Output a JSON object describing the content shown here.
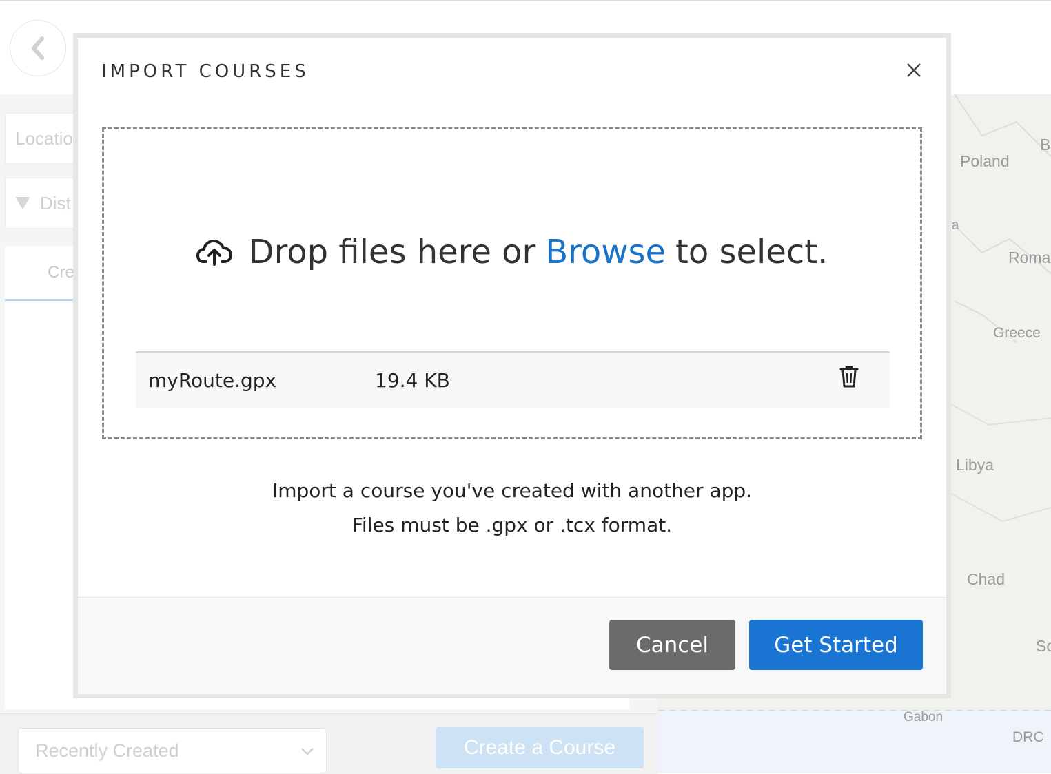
{
  "background": {
    "location_placeholder": "Locatio",
    "distance_label": "Dist",
    "tab_label": "Cre",
    "sort_select_value": "Recently Created",
    "create_course_label": "Create a Course",
    "map_labels": [
      "Poland",
      "tria",
      "Roma",
      "Greece",
      "Libya",
      "Chad",
      "Gabon",
      "DRC",
      "B",
      "So"
    ]
  },
  "modal": {
    "title": "IMPORT COURSES",
    "close_icon": "close-icon",
    "dropzone": {
      "upload_icon": "cloud-upload-icon",
      "text_before": "Drop files here or",
      "browse_link": "Browse",
      "text_after": "to select."
    },
    "files": [
      {
        "name": "myRoute.gpx",
        "size": "19.4 KB",
        "delete_icon": "trash-icon"
      }
    ],
    "description_line1": "Import a course you've created with another app.",
    "description_line2": "Files must be .gpx or .tcx format.",
    "cancel_label": "Cancel",
    "start_label": "Get Started"
  },
  "colors": {
    "accent": "#1a75d2",
    "link": "#1a73c9",
    "cancel_bg": "#6b6b6b"
  }
}
